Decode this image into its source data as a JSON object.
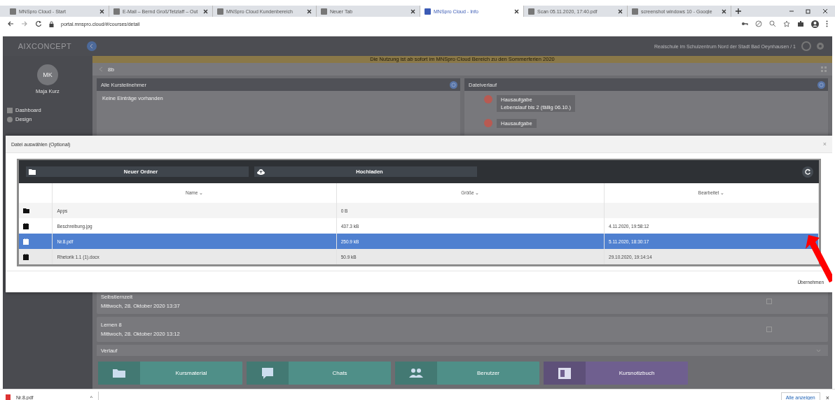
{
  "browser": {
    "tabs": [
      {
        "title": "MNSpro Cloud - Start",
        "selected": false
      },
      {
        "title": "E-Mail – Bernd Groß/Tetzlaff – Out",
        "selected": false
      },
      {
        "title": "MNSpro Cloud Kundenbereich",
        "selected": false
      },
      {
        "title": "Neuer Tab",
        "selected": false
      },
      {
        "title": "MNSpro Cloud - Info",
        "selected": true
      },
      {
        "title": "Scan 05.11.2020, 17:40.pdf",
        "selected": false
      },
      {
        "title": "screenshot windows 10 - Google",
        "selected": false
      }
    ],
    "address": "portal.mnspro.cloud/#/courses/detail"
  },
  "app": {
    "logo": "AIXCONCEPT",
    "school": "Realschule im Schulzentrum Nord der Stadt Bad Oeynhausen / 1",
    "banner": "Die Nutzung ist ab sofort im MNSpro Cloud Bereich zu den Sommerferien 2020",
    "user": {
      "initials": "MK",
      "name": "Maja Kurz"
    },
    "sidebar": [
      {
        "label": "Dashboard"
      },
      {
        "label": "Design"
      }
    ],
    "course": "8b",
    "left_panel": {
      "title": "Alle Kursteilnehmer",
      "empty": "Keine Einträge vorhanden"
    },
    "right_panel": {
      "title": "Dateiverlauf",
      "entries": [
        {
          "title": "Hausaufgabe",
          "subtitle": "Lebenslauf bis 2 (fällig 06.10.)"
        },
        {
          "title": "Hausaufgabe"
        }
      ]
    },
    "list": [
      {
        "title": "Selbstlernzeit",
        "date": "Mittwoch, 28. Oktober 2020 13:37"
      },
      {
        "title": "Lernen 8",
        "date": "Mittwoch, 28. Oktober 2020 13:12"
      }
    ],
    "section": "Verlauf",
    "tiles": [
      {
        "label": "Kursmaterial",
        "kind": "folder",
        "color": "#4f8f88"
      },
      {
        "label": "Chats",
        "kind": "chat",
        "color": "#4f8f88"
      },
      {
        "label": "Benutzer",
        "kind": "users",
        "color": "#4f8f88"
      },
      {
        "label": "Kursnotizbuch",
        "kind": "notebook",
        "color": "#6f5f8f"
      }
    ]
  },
  "dialog": {
    "title": "Datei auswählen (Optional)",
    "close": "×",
    "buttons": [
      {
        "label": "Neuer Ordner",
        "kind": "folder"
      },
      {
        "label": "Hochladen",
        "kind": "upload"
      }
    ],
    "columns": [
      "Name ⌄",
      "Größe ⌄",
      "Bearbeitet ⌄"
    ],
    "rows": [
      {
        "kind": "folder",
        "name": "Apps",
        "size": "0 B",
        "modified": "",
        "selected": false
      },
      {
        "kind": "file",
        "name": "Beschreibung.jpg",
        "size": "437.3 kB",
        "modified": "4.11.2020, 19:58:12",
        "selected": false
      },
      {
        "kind": "file",
        "name": "Nr.8.pdf",
        "size": "250.9 kB",
        "modified": "5.11.2020, 18:30:17",
        "selected": true
      },
      {
        "kind": "file",
        "name": "Rhetorik 1.1 (1).docx",
        "size": "50.9 kB",
        "modified": "29.10.2020, 19:14:14",
        "selected": false
      }
    ],
    "confirm": "Übernehmen"
  },
  "downloads": {
    "file": "Nr.8.pdf",
    "caret": "^",
    "show_all": "Alle anzeigen",
    "close": "×"
  }
}
